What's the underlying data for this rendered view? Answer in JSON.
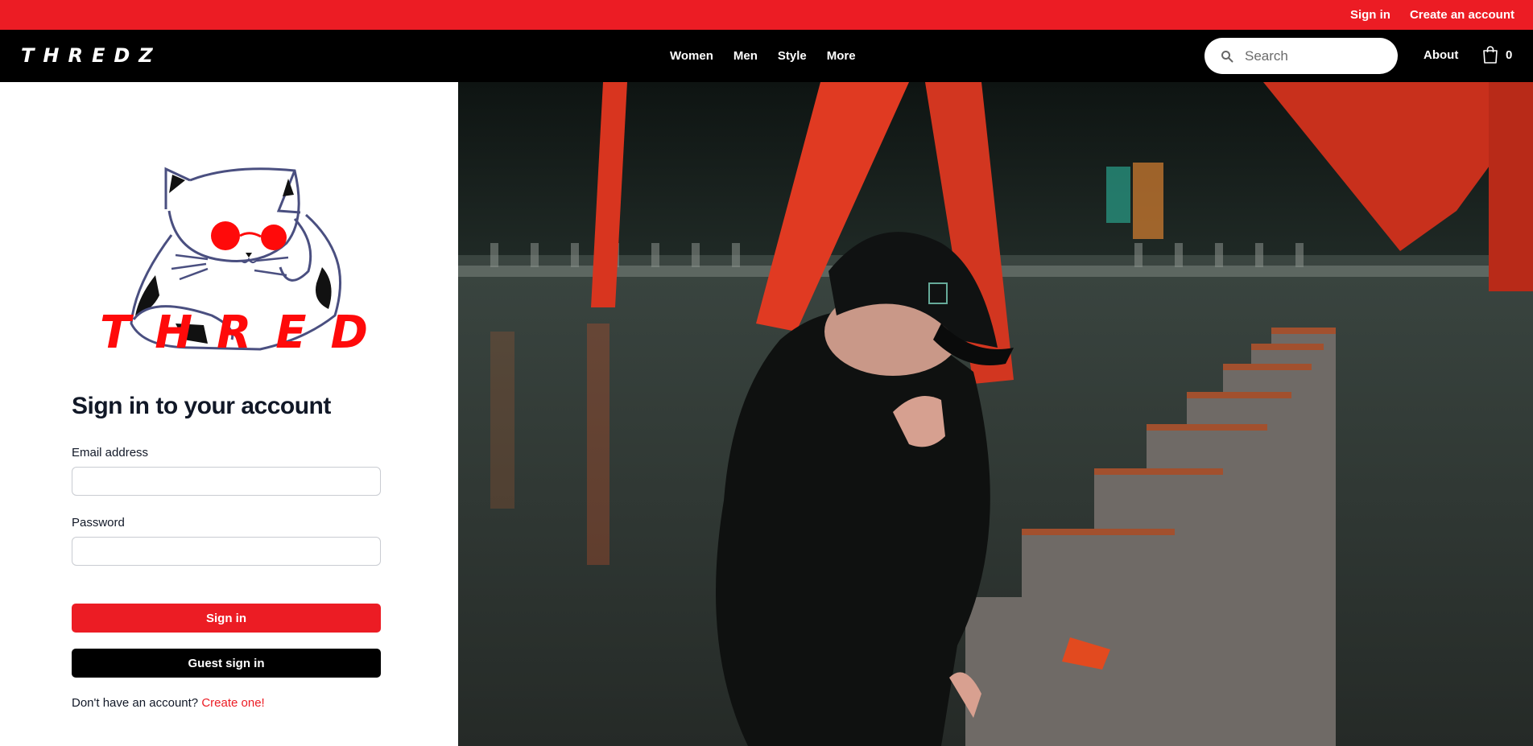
{
  "promo": {
    "sign_in": "Sign in",
    "create_account": "Create an account"
  },
  "header": {
    "logo": "THREDZ",
    "nav": [
      "Women",
      "Men",
      "Style",
      "More"
    ],
    "search_placeholder": "Search",
    "about": "About",
    "cart_count": "0"
  },
  "brand": {
    "logo_text": "THREDZ"
  },
  "form": {
    "title": "Sign in to your account",
    "email_label": "Email address",
    "email_value": "",
    "password_label": "Password",
    "password_value": "",
    "sign_in_button": "Sign in",
    "guest_button": "Guest sign in",
    "no_account": "Don't have an account?",
    "create_link": "Create one!"
  },
  "colors": {
    "accent": "#ec1c24",
    "nav_bg": "#000000",
    "text": "#111827"
  }
}
